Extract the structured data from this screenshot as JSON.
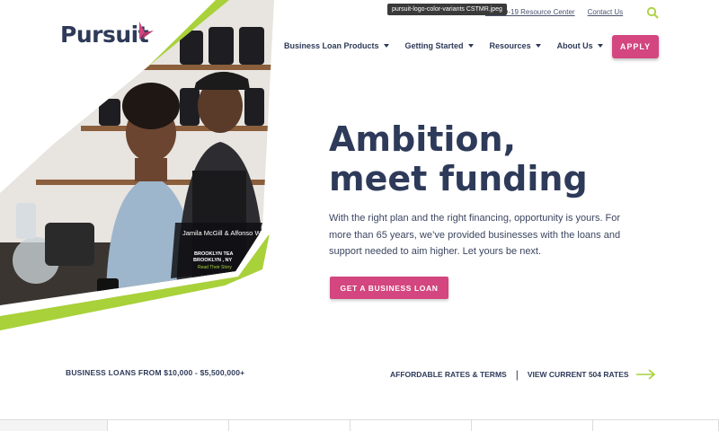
{
  "brand": {
    "name": "Pursuit",
    "accent": "#d3467f",
    "navy": "#2e3a59",
    "lime": "#a8d13a"
  },
  "tooltip": "pursuit-logo-color-variants CSTMR.jpeg",
  "utility": {
    "covid": "COVID-19 Resource Center",
    "contact": "Contact Us",
    "search_icon": "search-icon"
  },
  "nav": {
    "items": [
      {
        "label": "Business Loan Products"
      },
      {
        "label": "Getting Started"
      },
      {
        "label": "Resources"
      },
      {
        "label": "About Us"
      }
    ],
    "apply": "APPLY"
  },
  "hero": {
    "headline_line1": "Ambition,",
    "headline_line2": "meet funding",
    "lede": "With the right plan and the right financing, opportunity is yours. For more than 65 years, we’ve provided businesses with the loans and support needed to aim higher. Let yours be next.",
    "cta": "GET A BUSINESS LOAN",
    "photo_caption": {
      "names": "Jamila McGill & Alfonso Wright",
      "business": "BROOKLYN TEA",
      "location": "BROOKLYN , NY",
      "link": "Read Their Story"
    }
  },
  "bottom": {
    "left": "BUSINESS LOANS FROM $10,000 - $5,500,000+",
    "rates": "AFFORDABLE RATES & TERMS",
    "separator": "|",
    "view_rates": "VIEW CURRENT 504 RATES",
    "arrow_icon": "arrow-right-icon"
  }
}
